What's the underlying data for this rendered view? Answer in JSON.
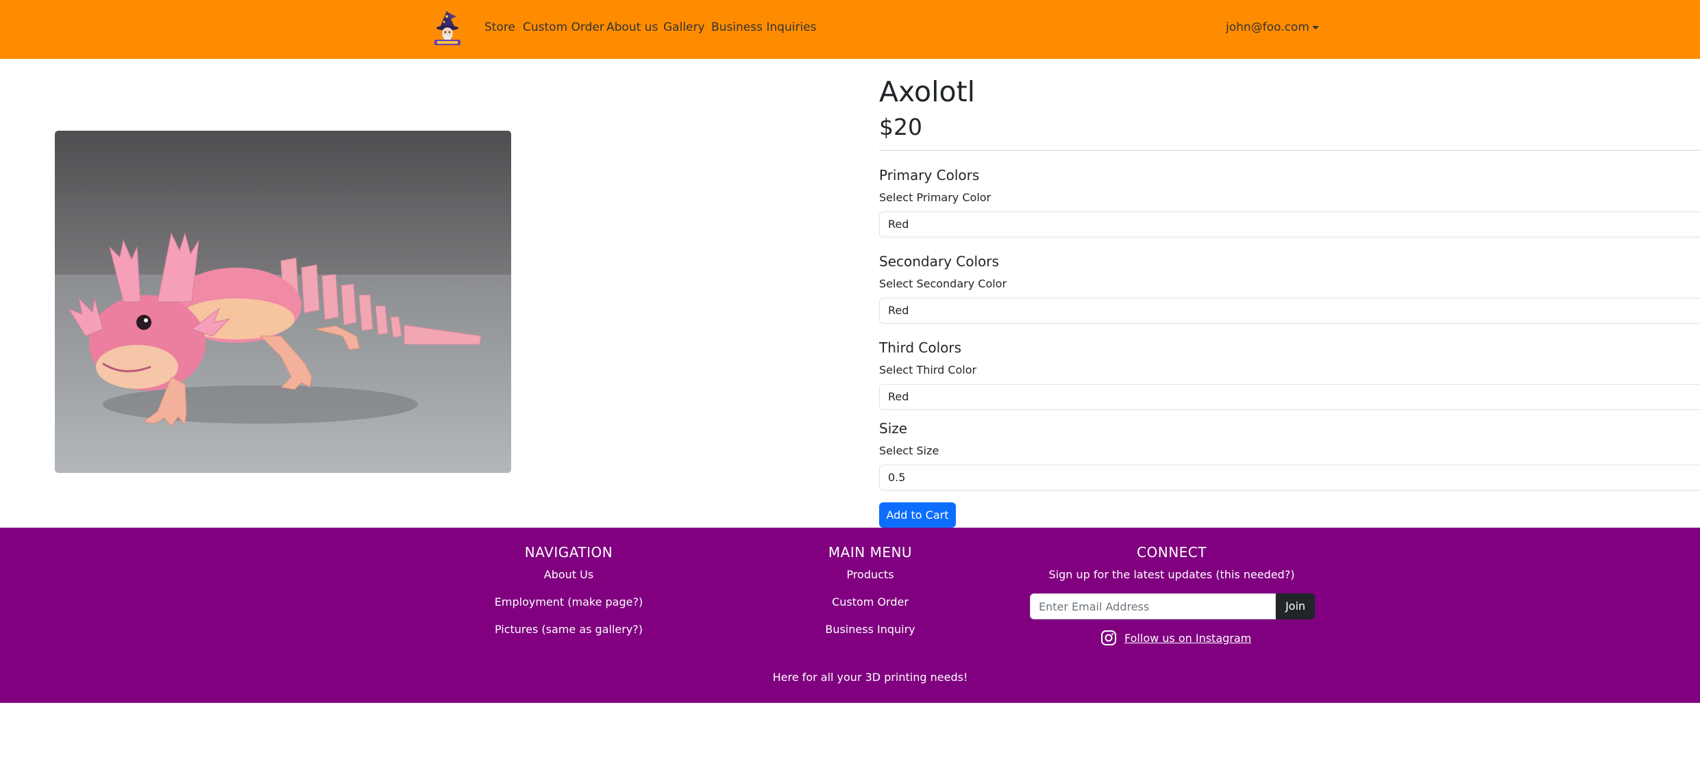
{
  "navbar": {
    "logo_icon": "wizard-logo-icon",
    "links": [
      "Store",
      "Custom Order",
      "About us",
      "Gallery",
      "Business Inquiries"
    ],
    "user": "john@foo.com",
    "background": "#ff8c00"
  },
  "product": {
    "title": "Axolotl",
    "price": "$20",
    "sections": [
      {
        "heading": "Primary Colors",
        "label": "Select Primary Color",
        "value": "Red"
      },
      {
        "heading": "Secondary Colors",
        "label": "Select Secondary Color",
        "value": "Red"
      },
      {
        "heading": "Third Colors",
        "label": "Select Third Color",
        "value": "Red"
      },
      {
        "heading": "Size",
        "label": "Select Size",
        "value": "0.5"
      }
    ],
    "add_to_cart": "Add to Cart",
    "button_color": "#0d6efd"
  },
  "footer": {
    "background": "#800080",
    "navigation": {
      "heading": "NAVIGATION",
      "links": [
        "About Us",
        "Employment (make page?)",
        "Pictures (same as gallery?)"
      ]
    },
    "main_menu": {
      "heading": "MAIN MENU",
      "links": [
        "Products",
        "Custom Order",
        "Business Inquiry"
      ]
    },
    "connect": {
      "heading": "CONNECT",
      "signup_text": "Sign up for the latest updates (this needed?)",
      "email_placeholder": "Enter Email Address",
      "join_label": "Join",
      "instagram_icon": "instagram-icon",
      "instagram_label": "Follow us on Instagram"
    },
    "tagline": "Here for all your 3D printing needs!"
  }
}
